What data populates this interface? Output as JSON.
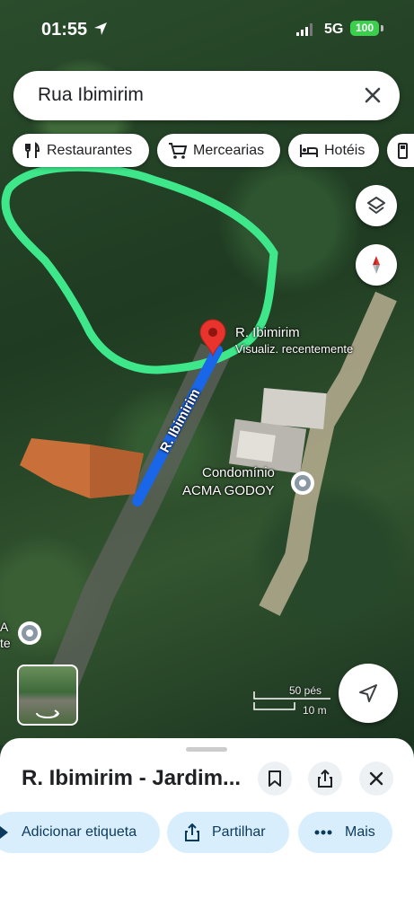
{
  "status_bar": {
    "time": "01:55",
    "network": "5G",
    "battery": "100"
  },
  "search": {
    "value": "Rua Ibimirim"
  },
  "chips": [
    {
      "label": "Restaurantes",
      "icon": "restaurant-icon"
    },
    {
      "label": "Mercearias",
      "icon": "cart-icon"
    },
    {
      "label": "Hotéis",
      "icon": "hotel-icon"
    },
    {
      "label": "",
      "icon": "gas-station-icon"
    }
  ],
  "map": {
    "pin": {
      "title": "R. Ibimirim",
      "subtitle": "Visualiz. recentemente"
    },
    "street_label": "R. Ibimirim",
    "poi_condominio": {
      "line1": "Condomínio",
      "line2": "ACMA GODOY"
    },
    "poi_left_fragment_1": "A",
    "poi_left_fragment_2": "te",
    "scale": {
      "feet": "50 pés",
      "meters": "10 m"
    },
    "colors": {
      "route": "#1a66e8",
      "highlight": "#3ee88a",
      "pin": "#e8342c"
    }
  },
  "place_sheet": {
    "title": "R. Ibimirim - Jardim...",
    "actions": [
      {
        "label": "Adicionar etiqueta",
        "icon": "label-icon"
      },
      {
        "label": "Partilhar",
        "icon": "share-icon"
      },
      {
        "label": "Mais",
        "icon": "more-icon"
      }
    ]
  }
}
